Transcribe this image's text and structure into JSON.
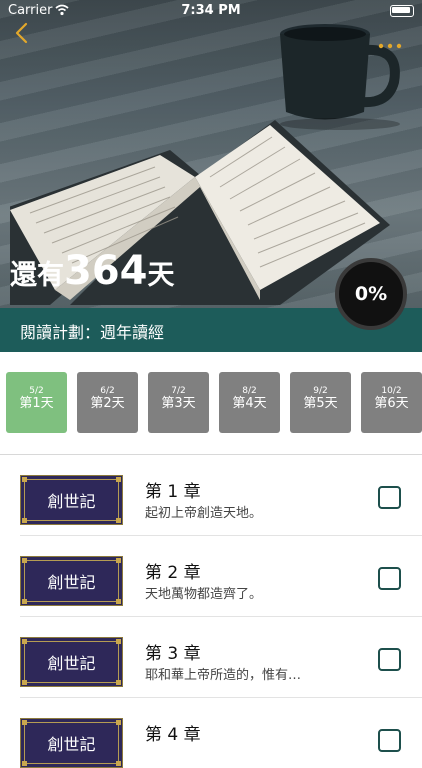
{
  "status_bar": {
    "carrier": "Carrier",
    "time": "7:34 PM"
  },
  "header": {
    "days_prefix": "還有",
    "days_number": "364",
    "days_suffix": "天",
    "progress": "0%",
    "plan_label": "閱讀計劃：週年讀經"
  },
  "days": [
    {
      "date": "5/2",
      "label": "第1天",
      "active": true
    },
    {
      "date": "6/2",
      "label": "第2天",
      "active": false
    },
    {
      "date": "7/2",
      "label": "第3天",
      "active": false
    },
    {
      "date": "8/2",
      "label": "第4天",
      "active": false
    },
    {
      "date": "9/2",
      "label": "第5天",
      "active": false
    },
    {
      "date": "10/2",
      "label": "第6天",
      "active": false
    }
  ],
  "chapters": [
    {
      "book": "創世記",
      "title": "第 1 章",
      "desc": "起初上帝創造天地。",
      "checked": false
    },
    {
      "book": "創世記",
      "title": "第 2 章",
      "desc": "天地萬物都造齊了。",
      "checked": false
    },
    {
      "book": "創世記",
      "title": "第 3 章",
      "desc": "耶和華上帝所造的，惟有…",
      "checked": false
    },
    {
      "book": "創世記",
      "title": "第 4 章",
      "desc": "",
      "checked": false
    }
  ],
  "colors": {
    "plan_bar": "#1d5c5a",
    "day_active": "#7fc07f",
    "day_inactive": "#808080",
    "accent_gold": "#e3a82b",
    "badge_bg": "#2e2859"
  },
  "icons": {
    "back": "chevron-left-icon",
    "more": "more-horizontal-icon",
    "wifi": "wifi-icon",
    "battery": "battery-icon"
  }
}
